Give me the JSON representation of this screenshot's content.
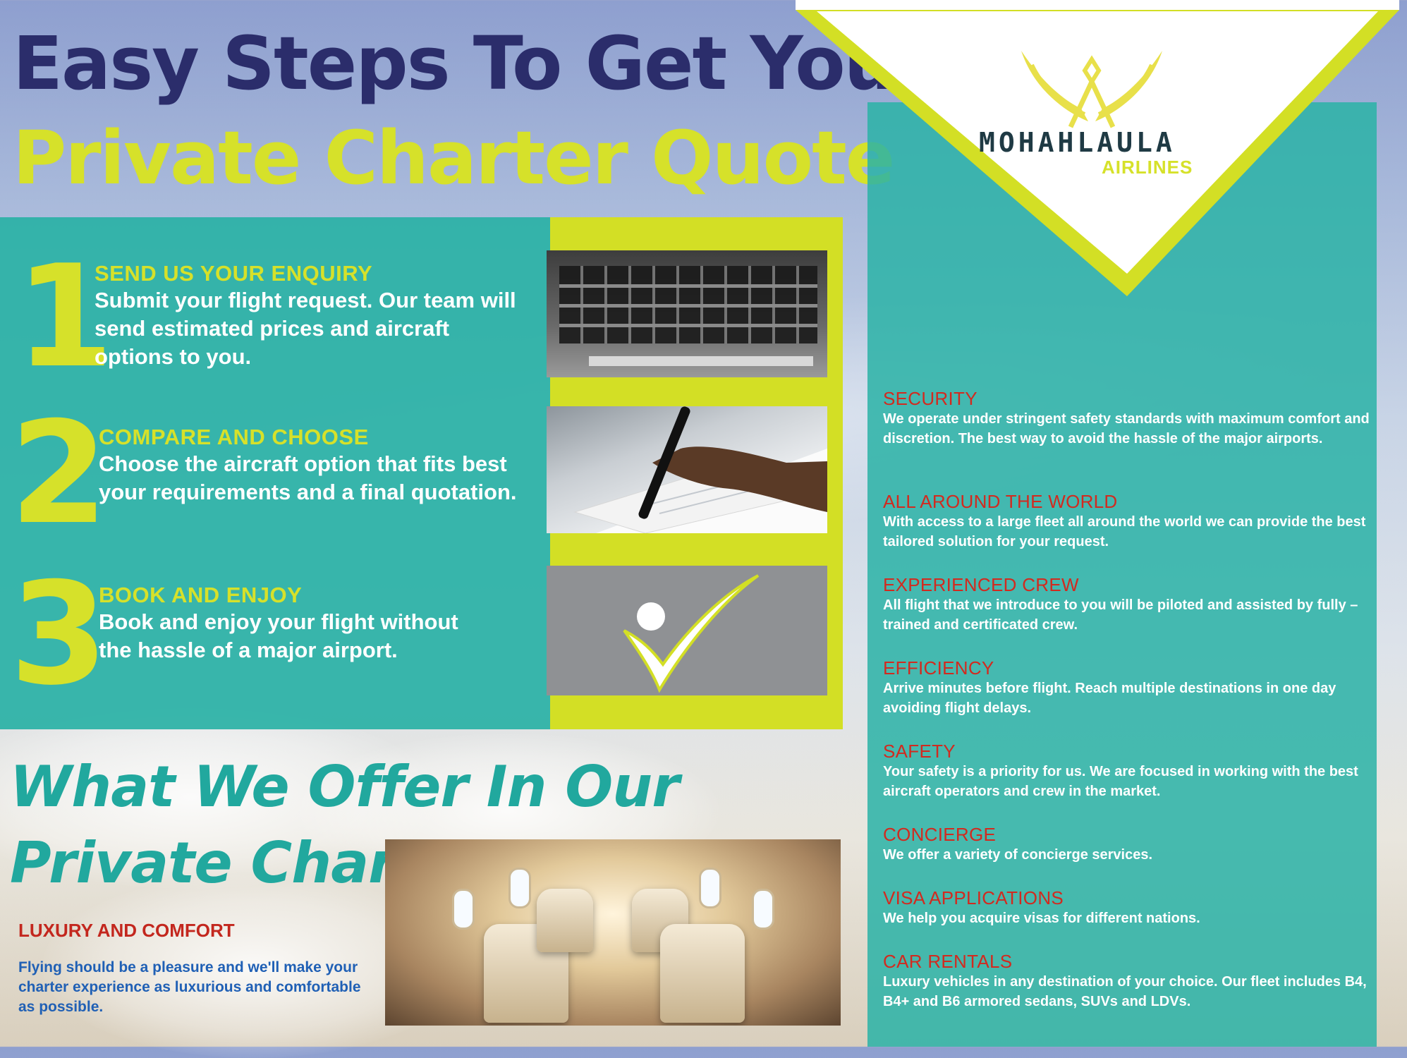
{
  "headline": {
    "line1": "Easy Steps To Get Your",
    "line2": "Private Charter Quote"
  },
  "steps": [
    {
      "number": "1",
      "title": "SEND US YOUR ENQUIRY",
      "description": "Submit your flight request. Our team will send estimated prices and aircraft options to you."
    },
    {
      "number": "2",
      "title": "COMPARE AND CHOOSE",
      "description": "Choose the aircraft option that fits best your requirements and a final quotation."
    },
    {
      "number": "3",
      "title": "BOOK AND ENJOY",
      "description": "Book and enjoy your flight without the hassle of a major airport."
    }
  ],
  "brand": {
    "name": "MOHAHLAULA",
    "subtitle": "AIRLINES"
  },
  "features": [
    {
      "title": "SECURITY",
      "description": "We operate under stringent safety standards with maximum comfort and discretion. The best way to avoid the hassle of the major airports."
    },
    {
      "title": "ALL AROUND THE WORLD",
      "description": "With access to a large fleet all around the world we can provide the best tailored solution for your request."
    },
    {
      "title": "EXPERIENCED CREW",
      "description": "All flight that we introduce to you will be piloted and assisted by fully – trained and certificated crew."
    },
    {
      "title": "EFFICIENCY",
      "description": "Arrive minutes before flight. Reach multiple destinations in one day avoiding flight delays."
    },
    {
      "title": "SAFETY",
      "description": "Your safety is a priority for us. We are focused in working with the best aircraft operators and crew in the market."
    },
    {
      "title": "CONCIERGE",
      "description": "We offer a variety of concierge services."
    },
    {
      "title": "VISA APPLICATIONS",
      "description": "We help you acquire visas for different nations."
    },
    {
      "title": "CAR RENTALS",
      "description": "Luxury vehicles in any destination of your choice. Our fleet includes B4, B4+ and B6 armored sedans, SUVs and LDVs."
    }
  ],
  "offer": {
    "heading": "What We Offer In Our Private Charter",
    "luxury_title": "LUXURY AND COMFORT",
    "luxury_description": "Flying should be a pleasure and we'll make your charter experience as luxurious and comfortable as possible."
  },
  "colors": {
    "navy": "#2b2d6b",
    "lime": "#d6e12a",
    "teal": "#2bb2a6",
    "red": "#d22a1f",
    "blue": "#2060b5"
  },
  "icons": {
    "logo": "winged-emblem-icon",
    "check": "checkmark-icon"
  }
}
